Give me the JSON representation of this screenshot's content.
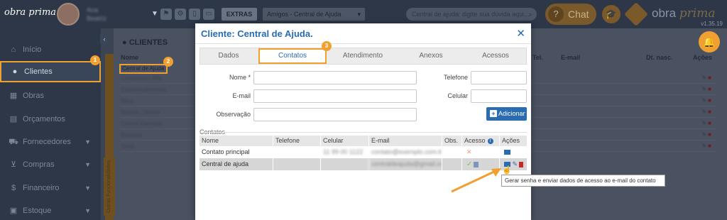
{
  "topbar": {
    "logo": "obra prima",
    "user_name_line1": "Ana",
    "user_name_line2": "Beatriz",
    "extras_label": "EXTRAS",
    "context_select": "Amigos - Central de Ajuda",
    "search_placeholder": "Central de ajuda: digite sua dúvida aqui...",
    "chat_label": "Chat",
    "brand_text": "obra",
    "brand_italic": "prima",
    "version": "v1.35.19"
  },
  "sidebar": {
    "items": [
      {
        "label": "Início",
        "icon": "home-icon",
        "glyph": "⌂"
      },
      {
        "label": "Clientes",
        "icon": "user-icon",
        "glyph": "●"
      },
      {
        "label": "Obras",
        "icon": "building-icon",
        "glyph": "▦"
      },
      {
        "label": "Orçamentos",
        "icon": "calculator-icon",
        "glyph": "▤"
      },
      {
        "label": "Fornecedores",
        "icon": "truck-icon",
        "glyph": "⛟"
      },
      {
        "label": "Compras",
        "icon": "cart-icon",
        "glyph": "⊻"
      },
      {
        "label": "Financeiro",
        "icon": "dollar-icon",
        "glyph": "$"
      },
      {
        "label": "Estoque",
        "icon": "box-icon",
        "glyph": "▣"
      }
    ],
    "vertical_tab": "Outras Funcionalidades"
  },
  "main": {
    "title": "CLIENTES",
    "columns": [
      "Nome",
      "Tel.",
      "E-mail",
      "Dt. nasc.",
      "Ações"
    ],
    "highlighted_row": "Central de Ajuda",
    "rows": [
      "Construtora Alfa",
      "Empreendimentos",
      "Silva",
      "Marcos Oliveira",
      "Cliente Exemplo",
      "Barbosa",
      "Teste"
    ]
  },
  "badges": [
    "1",
    "2",
    "3"
  ],
  "modal": {
    "title": "Cliente: Central de Ajuda.",
    "tabs": [
      "Dados",
      "Contatos",
      "Atendimento",
      "Anexos",
      "Acessos"
    ],
    "form": {
      "nome_label": "Nome *",
      "email_label": "E-mail",
      "observacao_label": "Observação",
      "telefone_label": "Telefone",
      "celular_label": "Celular",
      "add_button": "Adicionar"
    },
    "contacts_section": "Contatos",
    "table": {
      "headers": [
        "Nome",
        "Telefone",
        "Celular",
        "E-mail",
        "Obs.",
        "Acesso",
        "Ações"
      ],
      "rows": [
        {
          "nome": "Contato principal",
          "telefone": "",
          "celular": "11 99 00 1122",
          "email": "contato@exemplo.com.br",
          "obs": ""
        },
        {
          "nome": "Central de ajuda",
          "telefone": "",
          "celular": "",
          "email": "centraldeajuda@gmail.com",
          "obs": ""
        }
      ]
    },
    "tooltip": "Gerar senha e enviar dados de acesso ao e-mail do contato"
  },
  "colors": {
    "accent": "#f0a030",
    "primary": "#2a6cb0",
    "sidebar": "#2d3748"
  }
}
